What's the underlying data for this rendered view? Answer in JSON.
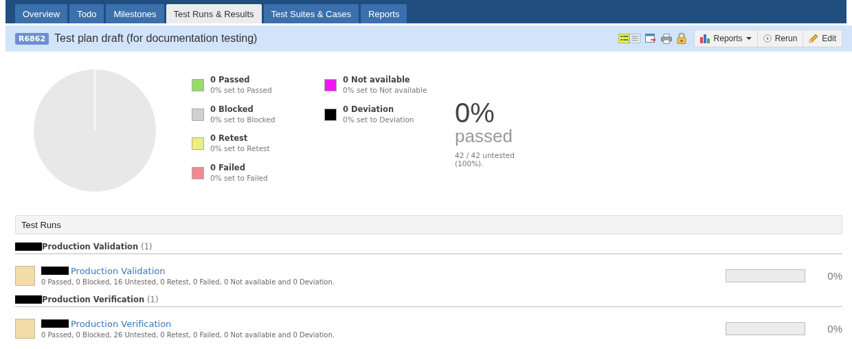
{
  "tabs": [
    {
      "label": "Overview",
      "selected": false
    },
    {
      "label": "Todo",
      "selected": false
    },
    {
      "label": "Milestones",
      "selected": false
    },
    {
      "label": "Test Runs & Results",
      "selected": true
    },
    {
      "label": "Test Suites & Cases",
      "selected": false
    },
    {
      "label": "Reports",
      "selected": false
    }
  ],
  "header": {
    "id_badge": "R6862",
    "title": "Test plan draft (for documentation testing)",
    "buttons": [
      {
        "label": "Reports",
        "kind": "dropdown"
      },
      {
        "label": "Rerun",
        "kind": "rerun"
      },
      {
        "label": "Edit",
        "kind": "edit"
      }
    ]
  },
  "legend": [
    {
      "label": "0 Passed",
      "detail": "0% set to Passed",
      "color": "#97dc6a"
    },
    {
      "label": "0 Blocked",
      "detail": "0% set to Blocked",
      "color": "#d0d0d0"
    },
    {
      "label": "0 Retest",
      "detail": "0% set to Retest",
      "color": "#eeee7f"
    },
    {
      "label": "0 Failed",
      "detail": "0% set to Failed",
      "color": "#f08a91"
    },
    {
      "label": "0 Not available",
      "detail": "0% set to Not available",
      "color": "#f416f4"
    },
    {
      "label": "0 Deviation",
      "detail": "0% set to Deviation",
      "color": "#000000"
    }
  ],
  "summary": {
    "percent": "0%",
    "caption": "passed",
    "untested": "42 / 42 untested (100%)."
  },
  "test_runs": {
    "title": "Test Runs",
    "groups": [
      {
        "name": "Production Validation",
        "count": "(1)",
        "runs": [
          {
            "name": "Production Validation",
            "stats": "0 Passed, 0 Blocked, 16 Untested, 0 Retest, 0 Failed, 0 Not available and 0 Deviation.",
            "level": 0,
            "percent": "0%"
          }
        ]
      },
      {
        "name": "Production Verification",
        "count": "(1)",
        "runs": [
          {
            "name": "Production Verification",
            "stats": "0 Passed, 0 Blocked, 26 Untested, 0 Retest, 0 Failed, 0 Not available and 0 Deviation.",
            "level": 0,
            "percent": "0%"
          }
        ]
      }
    ]
  }
}
